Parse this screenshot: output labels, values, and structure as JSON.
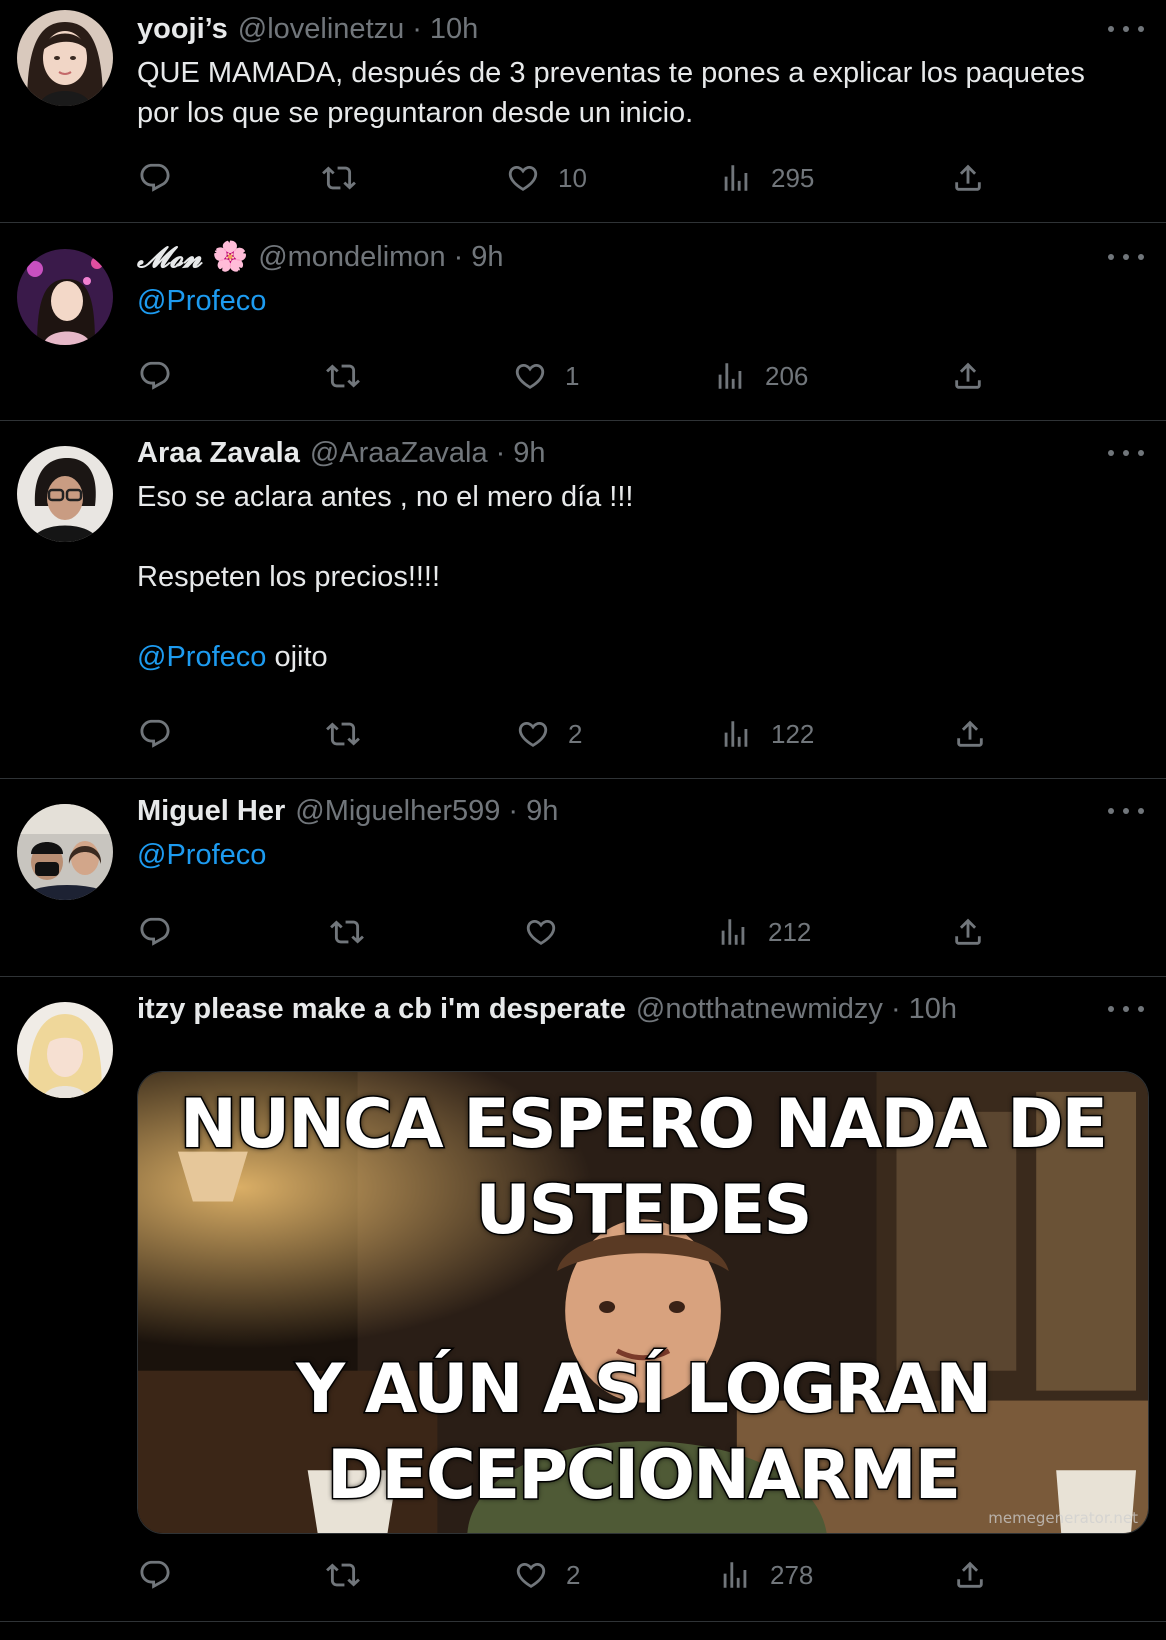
{
  "tweets": [
    {
      "name": "yooji’s",
      "handle": "@lovelinetzu",
      "time": "10h",
      "text_lines": [
        "QUE MAMADA, después de 3 preventas te pones a explicar los paquetes",
        "por los que se preguntaron desde un inicio."
      ],
      "likes": "10",
      "views": "295"
    },
    {
      "name": "𝓜𝓸𝓷",
      "name_emoji": "🌸",
      "handle": "@mondelimon",
      "time": "9h",
      "mention": "@Profeco",
      "likes": "1",
      "views": "206"
    },
    {
      "name": "Araa Zavala",
      "handle": "@AraaZavala",
      "time": "9h",
      "line1": "Eso se aclara antes , no el mero día !!!",
      "line2": "Respeten los precios!!!!",
      "mention": "@Profeco",
      "line3_rest": " ojito",
      "likes": "2",
      "views": "122"
    },
    {
      "name": "Miguel Her",
      "handle": "@Miguelher599",
      "time": "9h",
      "mention": "@Profeco",
      "views": "212"
    },
    {
      "name": "itzy please make a cb i'm desperate",
      "handle": "@notthatnewmidzy",
      "time": "10h",
      "meme_top_1": "NUNCA ESPERO NADA DE",
      "meme_top_2": "USTEDES",
      "meme_bottom_1": "Y AÚN ASÍ LOGRAN",
      "meme_bottom_2": "DECEPCIONARME",
      "watermark": "memegenerator.net",
      "likes": "2",
      "views": "278"
    }
  ],
  "sep": "·",
  "colors": {
    "background": "#000000",
    "text": "#e7e9ea",
    "muted": "#71767b",
    "link": "#1d9bf0",
    "divider": "#2f3336"
  }
}
